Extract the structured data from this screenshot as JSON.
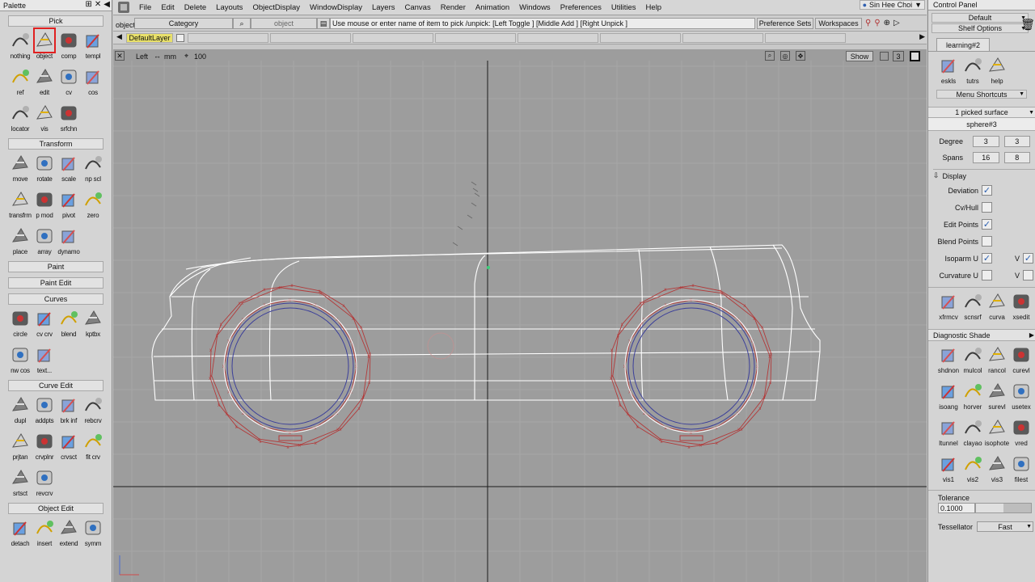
{
  "palette": {
    "title": "Palette",
    "sections": {
      "pick": "Pick",
      "transform": "Transform",
      "paint": "Paint",
      "paint_edit": "Paint Edit",
      "curves": "Curves",
      "curve_edit": "Curve Edit",
      "object_edit": "Object Edit"
    },
    "pick_tools": [
      "nothing",
      "object",
      "comp",
      "templ",
      "ref",
      "edit",
      "cv",
      "cos",
      "locator",
      "vis",
      "srfchn"
    ],
    "transform_tools": [
      "move",
      "rotate",
      "scale",
      "np scl",
      "transfrm",
      "p mod",
      "pivot",
      "zero",
      "place",
      "array",
      "dynamo"
    ],
    "curves_tools": [
      "circle",
      "cv crv",
      "blend",
      "kptbx",
      "nw cos",
      "text..."
    ],
    "curve_edit_tools": [
      "dupl",
      "addpts",
      "brk inf",
      "rebcrv",
      "prjtan",
      "crvplnr",
      "crvsct",
      "fit crv",
      "srtsct",
      "revcrv"
    ],
    "object_edit_tools": [
      "detach",
      "insert",
      "extend",
      "symm"
    ]
  },
  "menubar": {
    "items": [
      "File",
      "Edit",
      "Delete",
      "Layouts",
      "ObjectDisplay",
      "WindowDisplay",
      "Layers",
      "Canvas",
      "Render",
      "Animation",
      "Windows",
      "Preferences",
      "Utilities",
      "Help"
    ],
    "user": "Sin Hee Choi"
  },
  "toolbar2": {
    "mode": "object",
    "category": "Category",
    "object_field": "object",
    "prompt": "Use mouse or enter name of item to pick /unpick: [Left Toggle ] [Middle Add ] [Right Unpick ]",
    "preference_sets": "Preference Sets",
    "workspaces": "Workspaces"
  },
  "layers": {
    "default": "DefaultLayer"
  },
  "viewport": {
    "view": "Left",
    "unit": "mm",
    "scale": "100",
    "show": "Show",
    "view_number": "3"
  },
  "cpanel": {
    "title": "Control Panel",
    "default": "Default",
    "shelf_options": "Shelf Options",
    "shelf_tab": "learning#2",
    "shelf_tools": [
      "eskls",
      "tutrs",
      "help"
    ],
    "menu_shortcuts": "Menu Shortcuts",
    "picked": "1 picked surface",
    "name": "sphere#3",
    "degree_label": "Degree",
    "degree_u": "3",
    "degree_v": "3",
    "spans_label": "Spans",
    "spans_u": "16",
    "spans_v": "8",
    "display": "Display",
    "display_rows": [
      {
        "label": "Deviation",
        "checked": true
      },
      {
        "label": "Cv/Hull",
        "checked": false
      },
      {
        "label": "Edit Points",
        "checked": true
      },
      {
        "label": "Blend Points",
        "checked": false
      },
      {
        "label": "Isoparm U",
        "checked": true
      },
      {
        "label": "Curvature U",
        "checked": false
      }
    ],
    "v_label": "V",
    "tools_row": [
      "xfrmcv",
      "scnsrf",
      "curva",
      "xsedit"
    ],
    "diagnostic_shade": "Diagnostic Shade",
    "shade_tools": [
      "shdnon",
      "mulcol",
      "rancol",
      "curevl",
      "isoang",
      "horver",
      "surevl",
      "usetex",
      "ltunnel",
      "clayao",
      "isophote",
      "vred",
      "vis1",
      "vis2",
      "vis3",
      "filest"
    ],
    "tolerance_label": "Tolerance",
    "tolerance": "0.1000",
    "tessellator_label": "Tessellator",
    "tessellator": "Fast"
  },
  "colors": {
    "viewport_bg": "#9d9d9d",
    "wire": "#ffffff",
    "cv_hull": "#b23a3a",
    "circle": "#3b3f9a"
  }
}
